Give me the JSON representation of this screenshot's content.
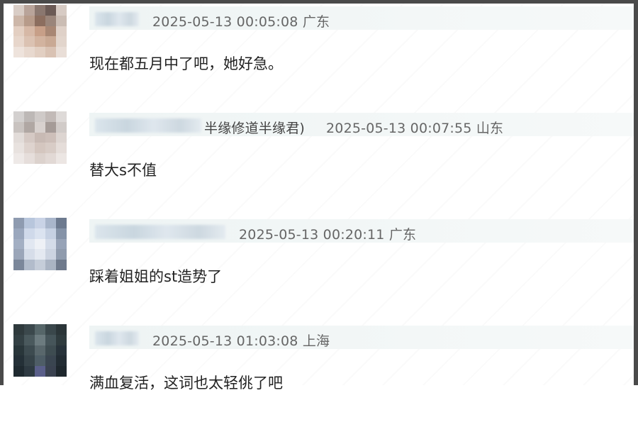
{
  "comments": [
    {
      "meta": "2025-05-13 00:05:08 广东",
      "text": "现在都五月中了吧，她好急。",
      "avatar_colors": [
        "#d9cdc6",
        "#b9a49a",
        "#8a776f",
        "#6b5a55",
        "#d7cbc4",
        "#cdb7a9",
        "#b79b8a",
        "#8c6e5f",
        "#9a857a",
        "#cbbdb4",
        "#e3cfc2",
        "#d6b8a6",
        "#c79f88",
        "#a88774",
        "#dfd1c8",
        "#e7d6cb",
        "#dbc2b2",
        "#d2b39f",
        "#c9a994",
        "#e2d5cc",
        "#eee3dc",
        "#e8d9cf",
        "#e2cfc2",
        "#d9c2b3",
        "#e9ded7"
      ]
    },
    {
      "meta_suffix": "半缘修道半缘君)",
      "meta": "2025-05-13 00:07:55 山东",
      "text": "替大s不值",
      "avatar_colors": [
        "#d3d0cf",
        "#bdb8b6",
        "#cfcac8",
        "#c2bab7",
        "#dedad8",
        "#c9c3c0",
        "#b0a7a3",
        "#d8d1ce",
        "#a59b97",
        "#d1cbc8",
        "#e2dcd9",
        "#d5c9c4",
        "#c8bab4",
        "#cdbfb9",
        "#ddd5d1",
        "#e8e2df",
        "#ded3ce",
        "#d4c6bf",
        "#d8ccc6",
        "#e5ddd9",
        "#eee9e7",
        "#e6dedb",
        "#dcd2cd",
        "#e2d9d5",
        "#ece6e3"
      ]
    },
    {
      "meta": "2025-05-13 00:20:11 广东",
      "text": "踩着姐姐的st造势了",
      "avatar_colors": [
        "#8e9bb0",
        "#b8c6dc",
        "#c9d3e6",
        "#a9b6cb",
        "#6d7a8f",
        "#9aa7bd",
        "#cfd9ea",
        "#dbe3f0",
        "#c6d1e3",
        "#8593a8",
        "#a3afc3",
        "#e1e7f1",
        "#eef1f6",
        "#d4dce9",
        "#97a3b7",
        "#9ba6b9",
        "#d6dde9",
        "#e4e9f1",
        "#ccd4e1",
        "#8f9bad",
        "#7b879a",
        "#b2bccb",
        "#c5cdd9",
        "#aab4c3",
        "#6f7a8c"
      ]
    },
    {
      "meta": "2025-05-13 01:03:08 上海",
      "text": "满血复活，这词也太轻佻了吧",
      "avatar_colors": [
        "#2f3a3d",
        "#3b484c",
        "#566669",
        "#3a474b",
        "#2b3538",
        "#334044",
        "#4a595d",
        "#6c7b7f",
        "#46555a",
        "#2f3b3e",
        "#29363a",
        "#3d4b50",
        "#59676c",
        "#3e4c51",
        "#27323a",
        "#243037",
        "#364349",
        "#4e5d66",
        "#3a4550",
        "#222c33",
        "#1f2a30",
        "#2e3a42",
        "#5a5f8a",
        "#3a4250",
        "#1e272d"
      ]
    }
  ],
  "colors": {
    "frame": "#4a4a4a",
    "meta_bar": "#eef4f4",
    "meta_text": "#666666",
    "body_text": "#222222"
  }
}
